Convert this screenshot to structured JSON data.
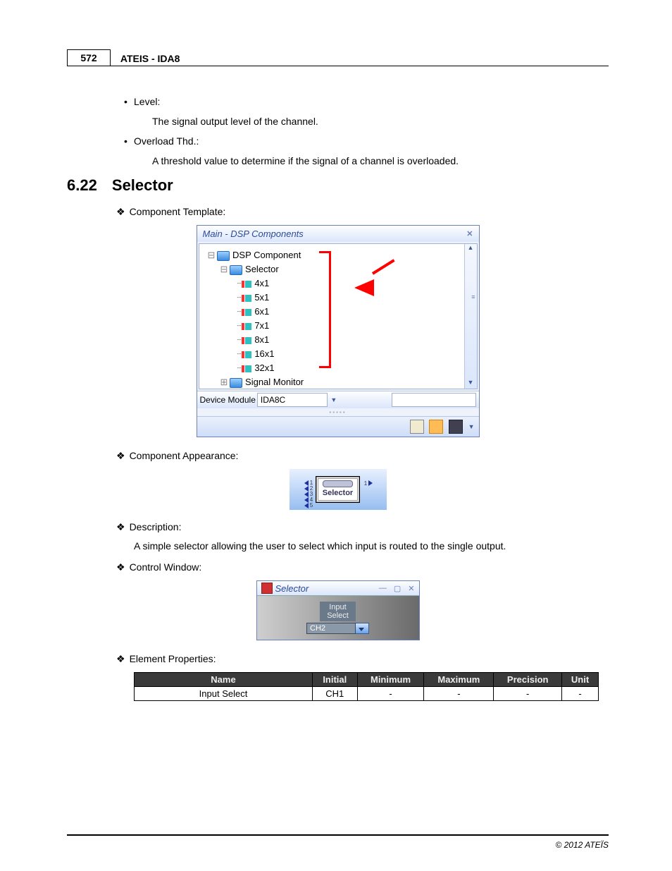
{
  "header": {
    "page_num": "572",
    "title": "ATEIS - IDA8"
  },
  "pre_list": {
    "item1": {
      "label": "Level:",
      "body": "The signal output level of the channel."
    },
    "item2": {
      "label": "Overload Thd.:",
      "body": "A threshold value to determine if the signal of a channel is overloaded."
    }
  },
  "section": {
    "num": "6.22",
    "title": "Selector"
  },
  "sub": {
    "template": "Component Template:",
    "appearance": "Component Appearance:",
    "description": "Description:",
    "description_body": "A simple selector allowing the user to select which input is routed to the single output.",
    "control": "Control Window:",
    "element_props": "Element Properties:"
  },
  "tree_window": {
    "title": "Main - DSP Components",
    "root": "DSP Component",
    "group": "Selector",
    "items": [
      "4x1",
      "5x1",
      "6x1",
      "7x1",
      "8x1",
      "16x1",
      "32x1"
    ],
    "sibling": "Signal Monitor",
    "module_label": "Device Module",
    "module_value": "IDA8C"
  },
  "appearance_block": {
    "label": "Selector",
    "left_nums": "1\n2\n3\n4\n5",
    "right_num": "1"
  },
  "ctrl_window": {
    "title": "Selector",
    "sub_label": "Input\nSelect",
    "value": "CH2"
  },
  "props_table": {
    "headers": [
      "Name",
      "Initial",
      "Minimum",
      "Maximum",
      "Precision",
      "Unit"
    ],
    "row": [
      "Input Select",
      "CH1",
      "-",
      "-",
      "-",
      "-"
    ]
  },
  "footer": "© 2012 ATEÏS"
}
